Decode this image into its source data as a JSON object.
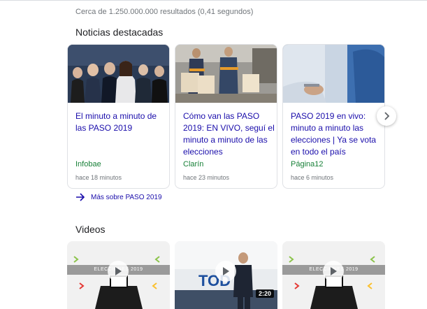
{
  "result_stats": "Cerca de 1.250.000.000 resultados (0,41 segundos)",
  "news": {
    "title": "Noticias destacadas",
    "items": [
      {
        "headline": "El minuto a minuto de las PASO 2019",
        "source": "Infobae",
        "time": "hace 18 minutos"
      },
      {
        "headline": "Cómo van las PASO 2019: EN VIVO, seguí el minuto a minuto de las elecciones",
        "source": "Clarín",
        "time": "hace 23 minutos"
      },
      {
        "headline": "PASO 2019 en vivo: minuto a minuto las elecciones | Ya se vota en todo el país",
        "source": "Página12",
        "time": "hace 6 minutos"
      }
    ],
    "more_link": "Más sobre PASO 2019"
  },
  "videos": {
    "title": "Videos",
    "items": [
      {
        "banner": "ELECCIONES 2019"
      },
      {
        "duration": "2:20"
      },
      {
        "banner": "ELECCIONES 2019"
      }
    ]
  },
  "icons": {
    "next": "chevron-right-icon",
    "more": "arrow-right-icon",
    "play": "play-icon"
  },
  "colors": {
    "link": "#1a0dab",
    "source": "#188038",
    "meta": "#70757a"
  }
}
